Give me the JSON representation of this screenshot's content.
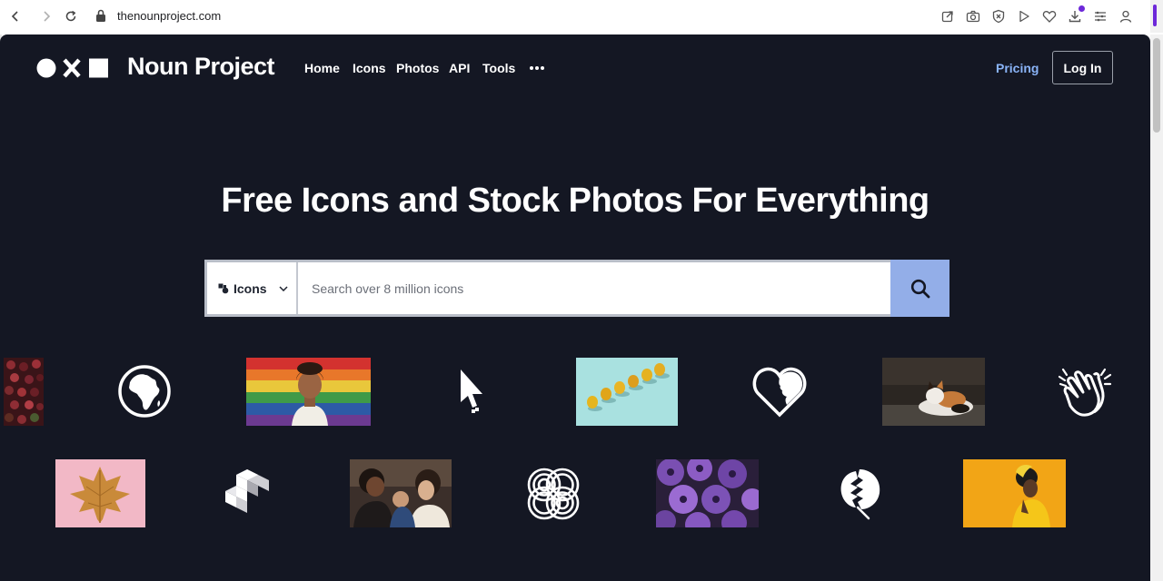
{
  "browser": {
    "url": "thenounproject.com"
  },
  "header": {
    "brand": "Noun Project",
    "nav": [
      "Home",
      "Icons",
      "Photos",
      "API",
      "Tools"
    ],
    "pricing": "Pricing",
    "login": "Log In"
  },
  "hero": {
    "title": "Free Icons and Stock Photos For Everything"
  },
  "search": {
    "type_label": "Icons",
    "placeholder": "Search over 8 million icons"
  },
  "colors": {
    "background": "#141723",
    "search_button": "#93aee8",
    "pricing_link": "#8ab4f8"
  },
  "gallery": {
    "row1": [
      "berries-photo",
      "africa-globe-icon",
      "rainbow-flag-portrait-photo",
      "cursor-arrow-icon",
      "pears-on-teal-photo",
      "heart-face-icon",
      "calico-cat-photo",
      "clapping-hands-icon"
    ],
    "row2": [
      "golden-leaf-on-pink-photo",
      "blocks-icon",
      "family-with-baby-photo",
      "interlocking-loops-icon",
      "purple-petunias-photo",
      "monstera-leaf-icon",
      "yellow-portrait-photo"
    ]
  }
}
